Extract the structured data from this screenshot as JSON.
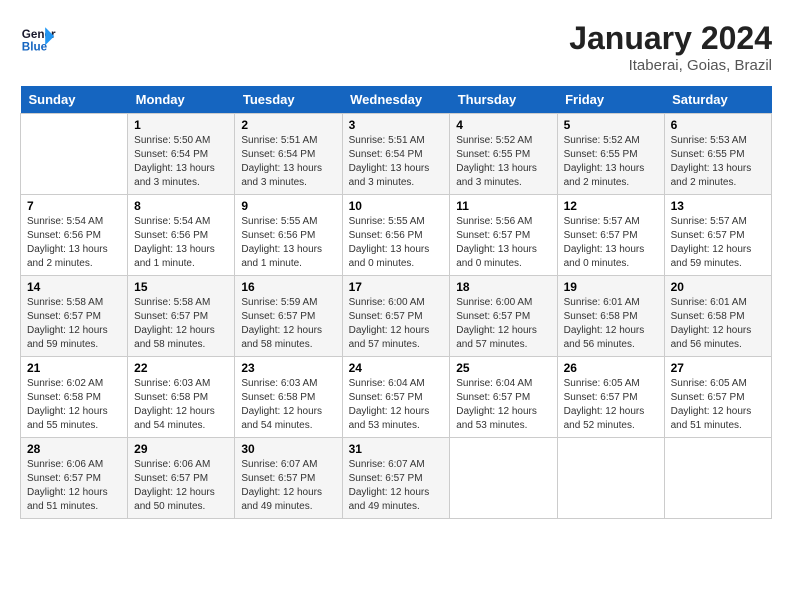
{
  "header": {
    "logo_general": "General",
    "logo_blue": "Blue",
    "title": "January 2024",
    "subtitle": "Itaberai, Goias, Brazil"
  },
  "calendar": {
    "days_of_week": [
      "Sunday",
      "Monday",
      "Tuesday",
      "Wednesday",
      "Thursday",
      "Friday",
      "Saturday"
    ],
    "weeks": [
      [
        {
          "day": "",
          "info": ""
        },
        {
          "day": "1",
          "info": "Sunrise: 5:50 AM\nSunset: 6:54 PM\nDaylight: 13 hours\nand 3 minutes."
        },
        {
          "day": "2",
          "info": "Sunrise: 5:51 AM\nSunset: 6:54 PM\nDaylight: 13 hours\nand 3 minutes."
        },
        {
          "day": "3",
          "info": "Sunrise: 5:51 AM\nSunset: 6:54 PM\nDaylight: 13 hours\nand 3 minutes."
        },
        {
          "day": "4",
          "info": "Sunrise: 5:52 AM\nSunset: 6:55 PM\nDaylight: 13 hours\nand 3 minutes."
        },
        {
          "day": "5",
          "info": "Sunrise: 5:52 AM\nSunset: 6:55 PM\nDaylight: 13 hours\nand 2 minutes."
        },
        {
          "day": "6",
          "info": "Sunrise: 5:53 AM\nSunset: 6:55 PM\nDaylight: 13 hours\nand 2 minutes."
        }
      ],
      [
        {
          "day": "7",
          "info": "Sunrise: 5:54 AM\nSunset: 6:56 PM\nDaylight: 13 hours\nand 2 minutes."
        },
        {
          "day": "8",
          "info": "Sunrise: 5:54 AM\nSunset: 6:56 PM\nDaylight: 13 hours\nand 1 minute."
        },
        {
          "day": "9",
          "info": "Sunrise: 5:55 AM\nSunset: 6:56 PM\nDaylight: 13 hours\nand 1 minute."
        },
        {
          "day": "10",
          "info": "Sunrise: 5:55 AM\nSunset: 6:56 PM\nDaylight: 13 hours\nand 0 minutes."
        },
        {
          "day": "11",
          "info": "Sunrise: 5:56 AM\nSunset: 6:57 PM\nDaylight: 13 hours\nand 0 minutes."
        },
        {
          "day": "12",
          "info": "Sunrise: 5:57 AM\nSunset: 6:57 PM\nDaylight: 13 hours\nand 0 minutes."
        },
        {
          "day": "13",
          "info": "Sunrise: 5:57 AM\nSunset: 6:57 PM\nDaylight: 12 hours\nand 59 minutes."
        }
      ],
      [
        {
          "day": "14",
          "info": "Sunrise: 5:58 AM\nSunset: 6:57 PM\nDaylight: 12 hours\nand 59 minutes."
        },
        {
          "day": "15",
          "info": "Sunrise: 5:58 AM\nSunset: 6:57 PM\nDaylight: 12 hours\nand 58 minutes."
        },
        {
          "day": "16",
          "info": "Sunrise: 5:59 AM\nSunset: 6:57 PM\nDaylight: 12 hours\nand 58 minutes."
        },
        {
          "day": "17",
          "info": "Sunrise: 6:00 AM\nSunset: 6:57 PM\nDaylight: 12 hours\nand 57 minutes."
        },
        {
          "day": "18",
          "info": "Sunrise: 6:00 AM\nSunset: 6:57 PM\nDaylight: 12 hours\nand 57 minutes."
        },
        {
          "day": "19",
          "info": "Sunrise: 6:01 AM\nSunset: 6:58 PM\nDaylight: 12 hours\nand 56 minutes."
        },
        {
          "day": "20",
          "info": "Sunrise: 6:01 AM\nSunset: 6:58 PM\nDaylight: 12 hours\nand 56 minutes."
        }
      ],
      [
        {
          "day": "21",
          "info": "Sunrise: 6:02 AM\nSunset: 6:58 PM\nDaylight: 12 hours\nand 55 minutes."
        },
        {
          "day": "22",
          "info": "Sunrise: 6:03 AM\nSunset: 6:58 PM\nDaylight: 12 hours\nand 54 minutes."
        },
        {
          "day": "23",
          "info": "Sunrise: 6:03 AM\nSunset: 6:58 PM\nDaylight: 12 hours\nand 54 minutes."
        },
        {
          "day": "24",
          "info": "Sunrise: 6:04 AM\nSunset: 6:57 PM\nDaylight: 12 hours\nand 53 minutes."
        },
        {
          "day": "25",
          "info": "Sunrise: 6:04 AM\nSunset: 6:57 PM\nDaylight: 12 hours\nand 53 minutes."
        },
        {
          "day": "26",
          "info": "Sunrise: 6:05 AM\nSunset: 6:57 PM\nDaylight: 12 hours\nand 52 minutes."
        },
        {
          "day": "27",
          "info": "Sunrise: 6:05 AM\nSunset: 6:57 PM\nDaylight: 12 hours\nand 51 minutes."
        }
      ],
      [
        {
          "day": "28",
          "info": "Sunrise: 6:06 AM\nSunset: 6:57 PM\nDaylight: 12 hours\nand 51 minutes."
        },
        {
          "day": "29",
          "info": "Sunrise: 6:06 AM\nSunset: 6:57 PM\nDaylight: 12 hours\nand 50 minutes."
        },
        {
          "day": "30",
          "info": "Sunrise: 6:07 AM\nSunset: 6:57 PM\nDaylight: 12 hours\nand 49 minutes."
        },
        {
          "day": "31",
          "info": "Sunrise: 6:07 AM\nSunset: 6:57 PM\nDaylight: 12 hours\nand 49 minutes."
        },
        {
          "day": "",
          "info": ""
        },
        {
          "day": "",
          "info": ""
        },
        {
          "day": "",
          "info": ""
        }
      ]
    ]
  }
}
